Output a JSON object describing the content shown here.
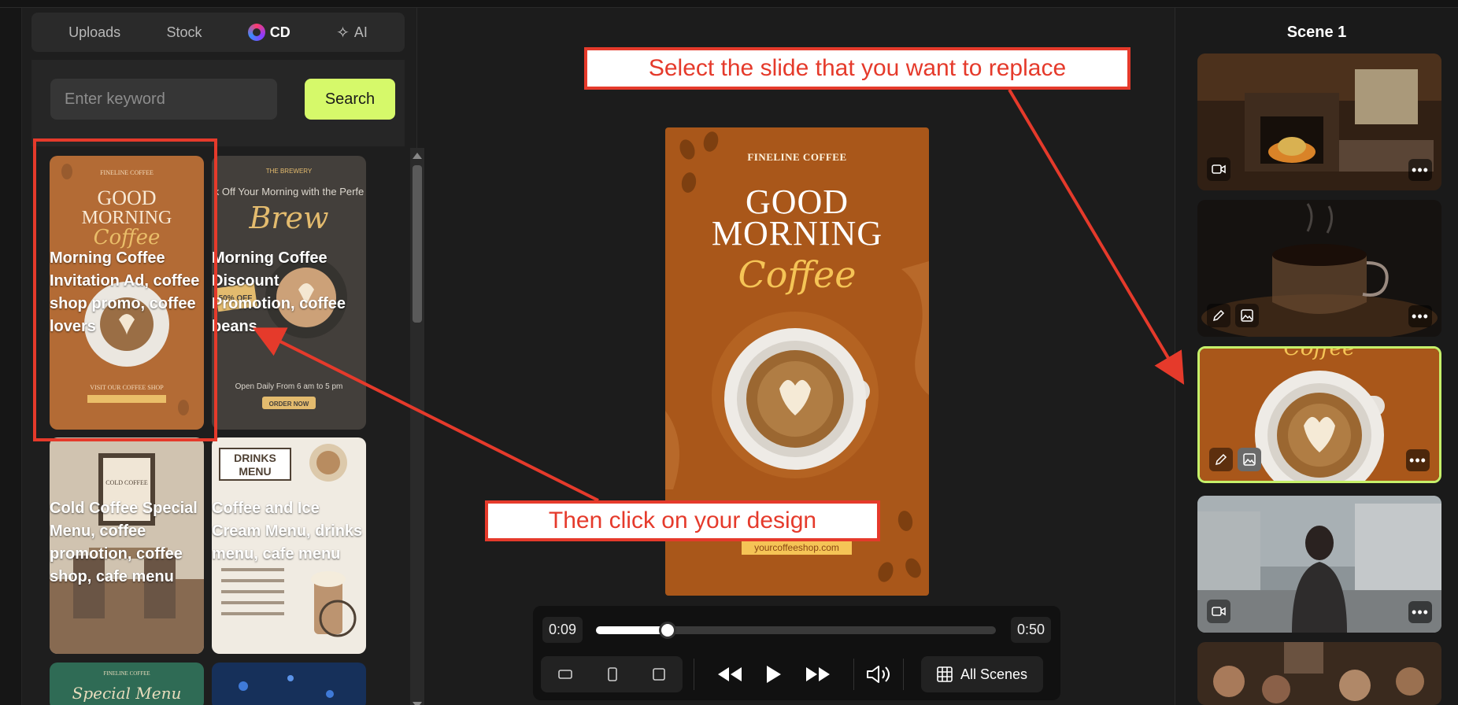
{
  "tabs": [
    {
      "label": "Uploads"
    },
    {
      "label": "Stock"
    },
    {
      "label": "CD"
    },
    {
      "label": "AI"
    }
  ],
  "search": {
    "placeholder": "Enter keyword",
    "button_label": "Search"
  },
  "templates": [
    {
      "title": "Morning Coffee Invitation Ad, coffee shop promo, coffee lovers"
    },
    {
      "title": "Morning Coffee Discount Promotion, coffee beans"
    },
    {
      "title": "Cold Coffee Special Menu, coffee promotion, coffee shop, cafe menu"
    },
    {
      "title": "Coffee and Ice Cream Menu, drinks menu, cafe menu"
    }
  ],
  "preview": {
    "brand": "FINELINE COFFEE",
    "headline_line1": "GOOD",
    "headline_line2": "MORNING",
    "script": "Coffee",
    "url": "yourcoffeeshop.com"
  },
  "player": {
    "current_time": "0:09",
    "total_time": "0:50",
    "progress": 0.18,
    "all_scenes_label": "All Scenes"
  },
  "callouts": {
    "select": "Select the slide that you want to replace",
    "click": "Then click on your design"
  },
  "scene_panel": {
    "title": "Scene 1"
  },
  "colors": {
    "accent": "#d6f96a",
    "callout": "#e53a2b",
    "preview_bg": "#a9571a"
  }
}
